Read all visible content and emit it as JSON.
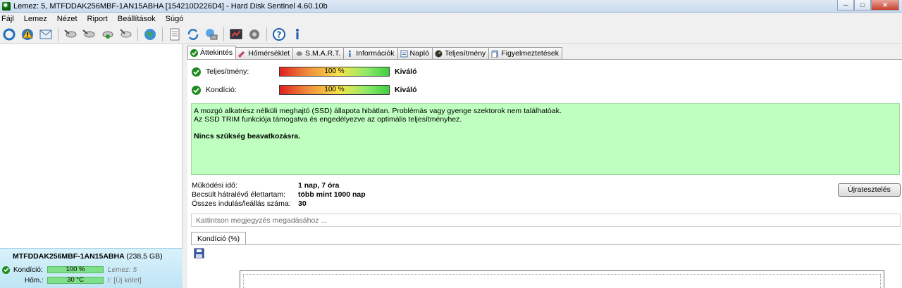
{
  "window": {
    "title": "Lemez: 5, MTFDDAK256MBF-1AN15ABHA [154210D226D4]  -  Hard Disk Sentinel 4.60.10b"
  },
  "menu": [
    {
      "label": "Fájl"
    },
    {
      "label": "Lemez"
    },
    {
      "label": "Nézet"
    },
    {
      "label": "Riport"
    },
    {
      "label": "Beállítások"
    },
    {
      "label": "Súgó"
    }
  ],
  "left_pane": {
    "disk": {
      "name": "MTFDDAK256MBF-1AN15ABHA",
      "size": "(238,5 GB)",
      "condition_label": "Kondíció:",
      "condition_value": "100 %",
      "disk_index": "Lemez: 5",
      "temp_label": "Hőm.:",
      "temp_value": "30 °C",
      "volume": "I: [Új kötet]"
    }
  },
  "tabs": [
    {
      "label": "Áttekintés",
      "icon": "check-icon"
    },
    {
      "label": "Hőmérséklet",
      "icon": "thermometer-icon"
    },
    {
      "label": "S.M.A.R.T.",
      "icon": "smart-icon"
    },
    {
      "label": "Információk",
      "icon": "info-icon"
    },
    {
      "label": "Napló",
      "icon": "log-icon"
    },
    {
      "label": "Teljesítmény",
      "icon": "performance-icon"
    },
    {
      "label": "Figyelmeztetések",
      "icon": "alerts-icon"
    }
  ],
  "overview": {
    "performance": {
      "label": "Teljesítmény:",
      "value": "100 %",
      "rating": "Kiváló"
    },
    "health": {
      "label": "Kondíció:",
      "value": "100 %",
      "rating": "Kiváló"
    },
    "message_line1": "A mozgó alkatrész nélküli meghajtó (SSD) állapota hibátlan. Problémás vagy gyenge szektorok nem találhatóak.",
    "message_line2": "Az SSD TRIM funkciója támogatva és engedélyezve az optimális teljesítményhez.",
    "message_bold": "Nincs szükség beavatkozásra.",
    "stats": [
      {
        "label": "Működési idő:",
        "value": "1 nap, 7 óra"
      },
      {
        "label": "Becsült hátralévő élettartam:",
        "value": "több mint 1000 nap"
      },
      {
        "label": "Összes indulás/leállás száma:",
        "value": "30"
      }
    ],
    "retest_button": "Újratesztelés",
    "notes_placeholder": "Kattintson megjegyzés megadásához ...",
    "subtab_label": "Kondíció  (%)"
  },
  "colors": {
    "good_green": "#bfffbf",
    "check_green": "#1f8a1f",
    "card_blue": "#cdebf8"
  }
}
